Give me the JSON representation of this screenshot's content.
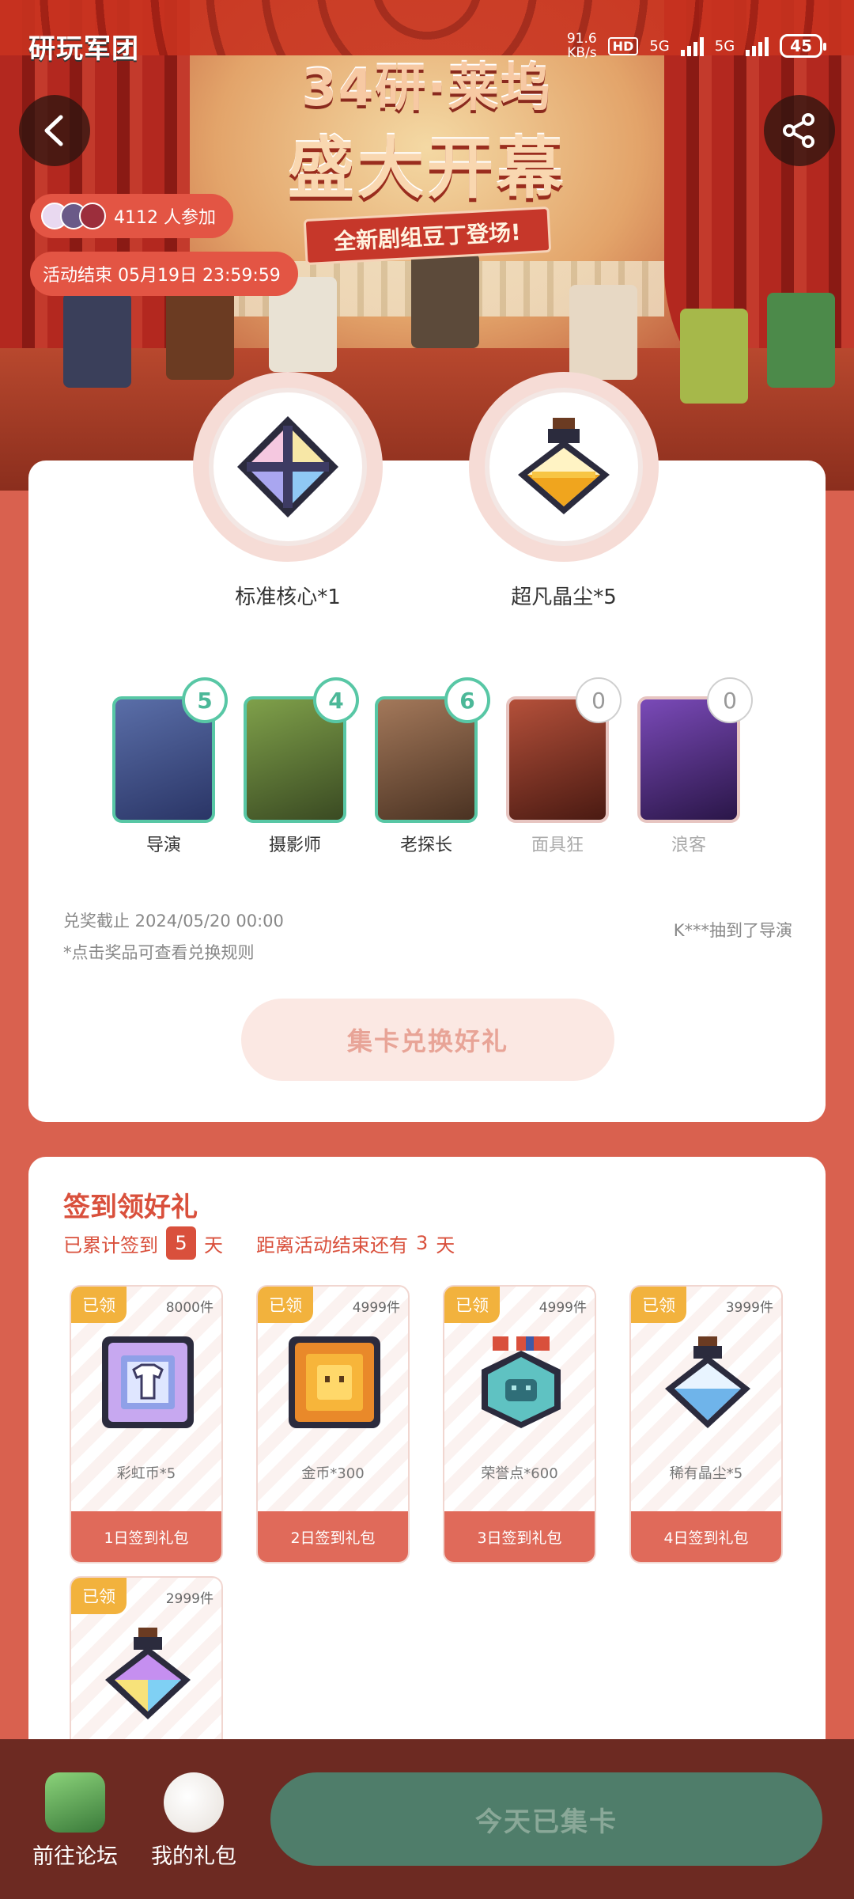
{
  "status_bar": {
    "brand": "研玩军团",
    "net_speed": "91.6",
    "net_unit": "KB/s",
    "hd_tag": "HD",
    "network_1": "5G",
    "network_2": "5G",
    "battery": "45"
  },
  "banner": {
    "title_line1": "34研·莱坞",
    "title_line2": "盛大开幕",
    "ribbon": "全新剧组豆丁登场!",
    "participants": "4112 人参加",
    "end_time": "活动结束 05月19日 23:59:59"
  },
  "rewards": [
    {
      "label": "标准核心*1",
      "icon": "core-crystal-icon"
    },
    {
      "label": "超凡晶尘*5",
      "icon": "gold-dust-bottle-icon"
    }
  ],
  "characters": [
    {
      "name": "导演",
      "count": "5",
      "collected": true,
      "color": "#3a4d8f"
    },
    {
      "name": "摄影师",
      "count": "4",
      "collected": true,
      "color": "#5e7a3a"
    },
    {
      "name": "老探长",
      "count": "6",
      "collected": true,
      "color": "#7a5a3a"
    },
    {
      "name": "面具狂",
      "count": "0",
      "collected": false,
      "color": "#8c3a28"
    },
    {
      "name": "浪客",
      "count": "0",
      "collected": false,
      "color": "#4a2e7a"
    }
  ],
  "exchange": {
    "deadline": "兑奖截止 2024/05/20 00:00",
    "rule_hint": "*点击奖品可查看兑换规则",
    "ticker": "K***抽到了导演",
    "button": "集卡兑换好礼"
  },
  "checkin": {
    "title": "签到领好礼",
    "cumulative_prefix": "已累计签到",
    "cumulative_days": "5",
    "cumulative_suffix": "天",
    "remaining_prefix": "距离活动结束还有",
    "remaining_days": "3",
    "remaining_suffix": "天",
    "gifts": [
      {
        "badge": "已领",
        "stock": "8000件",
        "name": "彩虹币*5",
        "button": "1日签到礼包",
        "icon": "rainbow-coin-icon"
      },
      {
        "badge": "已领",
        "stock": "4999件",
        "name": "金币*300",
        "button": "2日签到礼包",
        "icon": "gold-coin-icon"
      },
      {
        "badge": "已领",
        "stock": "4999件",
        "name": "荣誉点*600",
        "button": "3日签到礼包",
        "icon": "honor-medal-icon"
      },
      {
        "badge": "已领",
        "stock": "3999件",
        "name": "稀有晶尘*5",
        "button": "4日签到礼包",
        "icon": "blue-dust-bottle-icon"
      },
      {
        "badge": "已领",
        "stock": "2999件",
        "name": "",
        "button": "",
        "icon": "rainbow-dust-bottle-icon"
      }
    ]
  },
  "bottom_bar": {
    "forum": "前往论坛",
    "gifts": "我的礼包",
    "today": "今天已集卡"
  },
  "colors": {
    "accent": "#d9503c",
    "teal": "#58c7a5",
    "bottom_bar": "#6d2a22",
    "today_button": "#4f7d6a"
  }
}
